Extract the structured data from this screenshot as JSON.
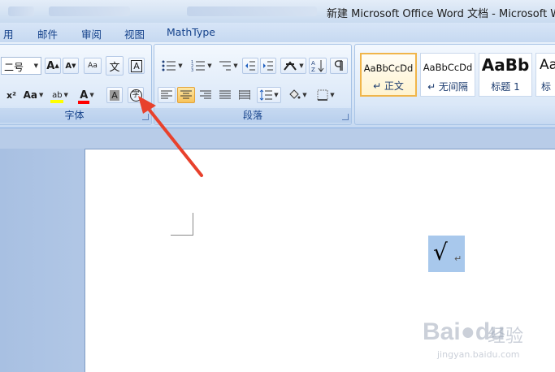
{
  "title_bar": {
    "title": "新建 Microsoft Office Word 文档 - Microsoft Wo"
  },
  "menu_tabs": [
    "用",
    "邮件",
    "审阅",
    "视图",
    "MathType"
  ],
  "ribbon": {
    "font_group": {
      "label": "字体",
      "font_size": "二号",
      "grow_font": "A",
      "shrink_font": "A",
      "clear_format": "Aa",
      "phonetic_guide": "文",
      "char_border": "A",
      "superscript": "x²",
      "change_case": "Aa",
      "highlight": "ab",
      "font_color": "A",
      "char_shading": "A",
      "enclose_char": "字"
    },
    "paragraph_group": {
      "label": "段落"
    },
    "styles": [
      {
        "sample": "AaBbCcDd",
        "name": "↵ 正文"
      },
      {
        "sample": "AaBbCcDd",
        "name": "↵ 无间隔"
      },
      {
        "sample": "AaBb",
        "name": "标题 1"
      },
      {
        "sample": "Aa",
        "name": "标"
      }
    ]
  },
  "document": {
    "check_mark": "√",
    "paragraph_mark": "↵"
  },
  "watermark": {
    "brand": "Bai",
    "brand2": "du",
    "cn": "经验",
    "url": "jingyan.baidu.com"
  },
  "colors": {
    "highlight_bar": "#ffff00",
    "font_color_bar": "#ff0000",
    "arrow": "#e8412c",
    "selection": "#a8c8ec"
  }
}
